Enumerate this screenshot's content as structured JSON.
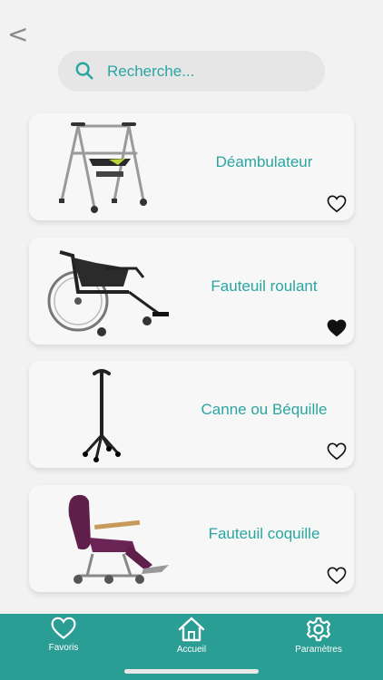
{
  "nav": {
    "back_label": "<"
  },
  "search": {
    "placeholder": "Recherche...",
    "icon": "search-icon"
  },
  "items": [
    {
      "label": "Déambulateur",
      "image": "walker-image",
      "favorite": false
    },
    {
      "label": "Fauteuil roulant",
      "image": "wheelchair-image",
      "favorite": true
    },
    {
      "label": "Canne ou  Béquille",
      "image": "cane-image",
      "favorite": false
    },
    {
      "label": "Fauteuil coquille",
      "image": "shell-chair-image",
      "favorite": false
    }
  ],
  "tabbar": {
    "items": [
      {
        "label": "Favoris",
        "icon": "heart-icon"
      },
      {
        "label": "Accueil",
        "icon": "home-icon"
      },
      {
        "label": "Paramètres",
        "icon": "gear-icon"
      }
    ]
  },
  "colors": {
    "accent": "#2aa6a1",
    "tabbar": "#2a9d94",
    "background": "#f2f2f2"
  }
}
